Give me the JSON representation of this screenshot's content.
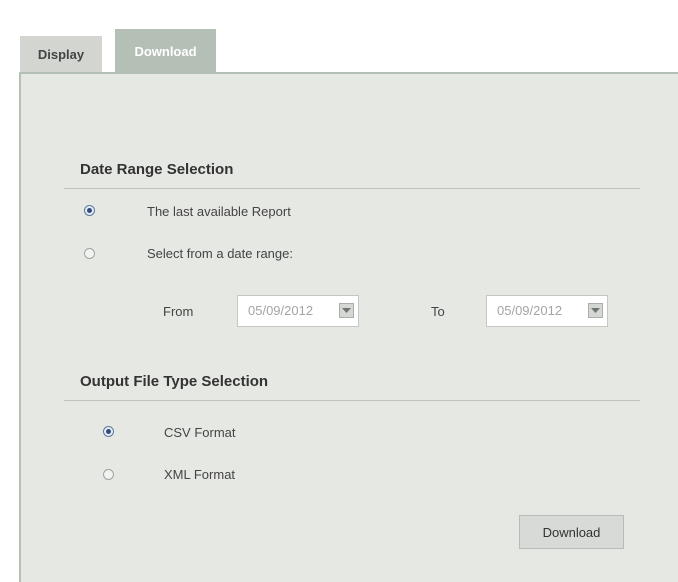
{
  "tabs": {
    "display_label": "Display",
    "download_label": "Download"
  },
  "date_range": {
    "title": "Date Range Selection",
    "option_last": "The last available Report",
    "option_range": "Select from a date range:",
    "from_label": "From",
    "from_value": "05/09/2012",
    "to_label": "To",
    "to_value": "05/09/2012"
  },
  "output_type": {
    "title": "Output File Type Selection",
    "option_csv": "CSV Format",
    "option_xml": "XML Format"
  },
  "actions": {
    "download_label": "Download"
  },
  "colors": {
    "active_tab": "#b4bfb5",
    "panel_background": "#e6e8e4",
    "radio_selected": "#2e4d7f"
  }
}
